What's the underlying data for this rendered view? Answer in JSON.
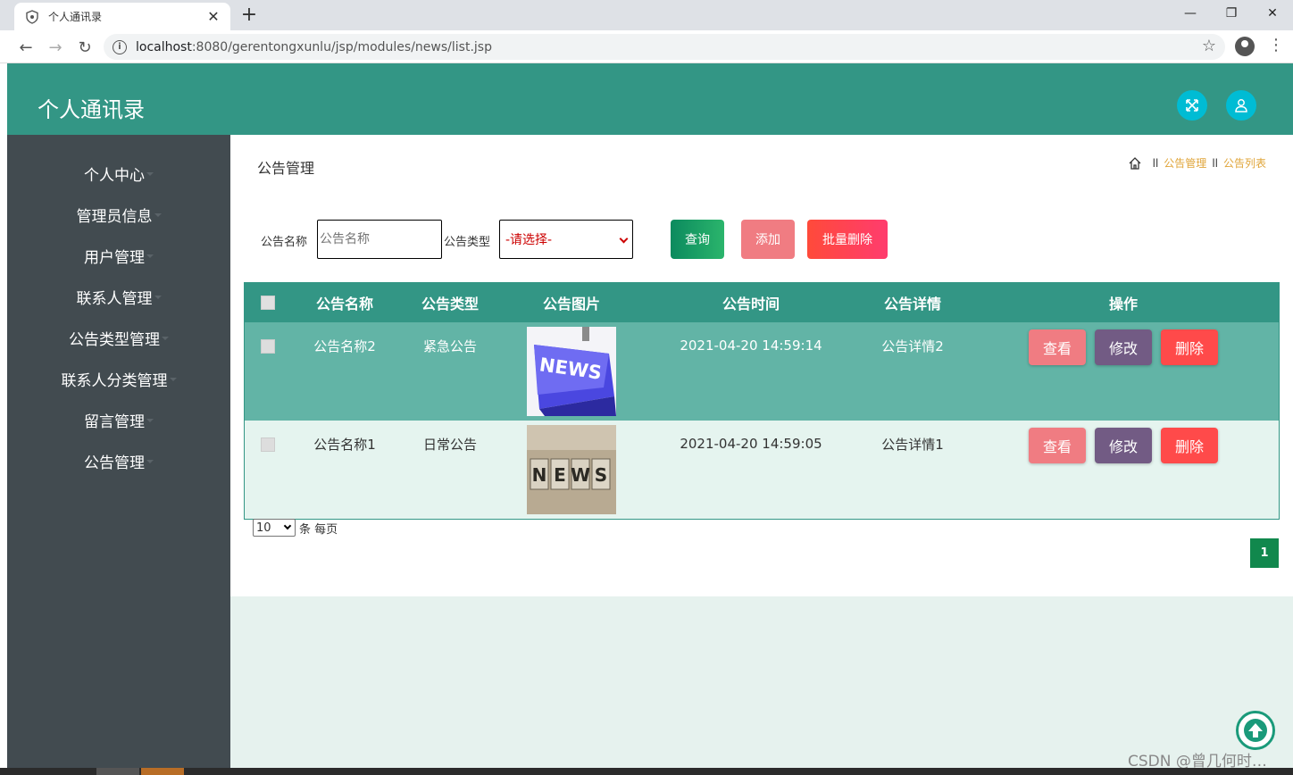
{
  "browser": {
    "tab_title": "个人通讯录",
    "url_host": "localhost",
    "url_rest": ":8080/gerentongxunlu/jsp/modules/news/list.jsp",
    "window_buttons": [
      "—",
      "❐",
      "✕"
    ]
  },
  "app": {
    "brand": "个人通讯录",
    "header_icons": [
      "fullscreen-icon",
      "user-icon"
    ]
  },
  "sidebar": {
    "items": [
      {
        "label": "个人中心"
      },
      {
        "label": "管理员信息"
      },
      {
        "label": "用户管理"
      },
      {
        "label": "联系人管理"
      },
      {
        "label": "公告类型管理"
      },
      {
        "label": "联系人分类管理"
      },
      {
        "label": "留言管理"
      },
      {
        "label": "公告管理"
      }
    ]
  },
  "page": {
    "title": "公告管理",
    "breadcrumb": {
      "sep": "ll",
      "items": [
        "公告管理",
        "公告列表"
      ]
    }
  },
  "search": {
    "name_label": "公告名称",
    "name_placeholder": "公告名称",
    "type_label": "公告类型",
    "type_value": "-请选择-",
    "query_button": "查询",
    "add_button": "添加",
    "batch_delete_button": "批量删除"
  },
  "table": {
    "columns": [
      "公告名称",
      "公告类型",
      "公告图片",
      "公告时间",
      "公告详情",
      "操作"
    ],
    "rows": [
      {
        "name": "公告名称2",
        "type": "紧急公告",
        "image": "news-keyboard-image",
        "time": "2021-04-20 14:59:14",
        "detail": "公告详情2"
      },
      {
        "name": "公告名称1",
        "type": "日常公告",
        "image": "news-blocks-image",
        "time": "2021-04-20 14:59:05",
        "detail": "公告详情1"
      }
    ],
    "actions": {
      "view": "查看",
      "edit": "修改",
      "delete": "删除"
    }
  },
  "pagination": {
    "page_size": "10",
    "page_size_suffix": "条 每页",
    "current_page": "1"
  },
  "watermark": "CSDN @曾几何时…",
  "colors": {
    "header": "#339685",
    "sidebar": "#424b50",
    "row_odd": "#62b4a6",
    "row_even": "#e5f4ef",
    "btn_query": "#11884d",
    "btn_add": "#f07c82",
    "btn_delete": "#ff4a4a",
    "btn_edit": "#725b84"
  }
}
